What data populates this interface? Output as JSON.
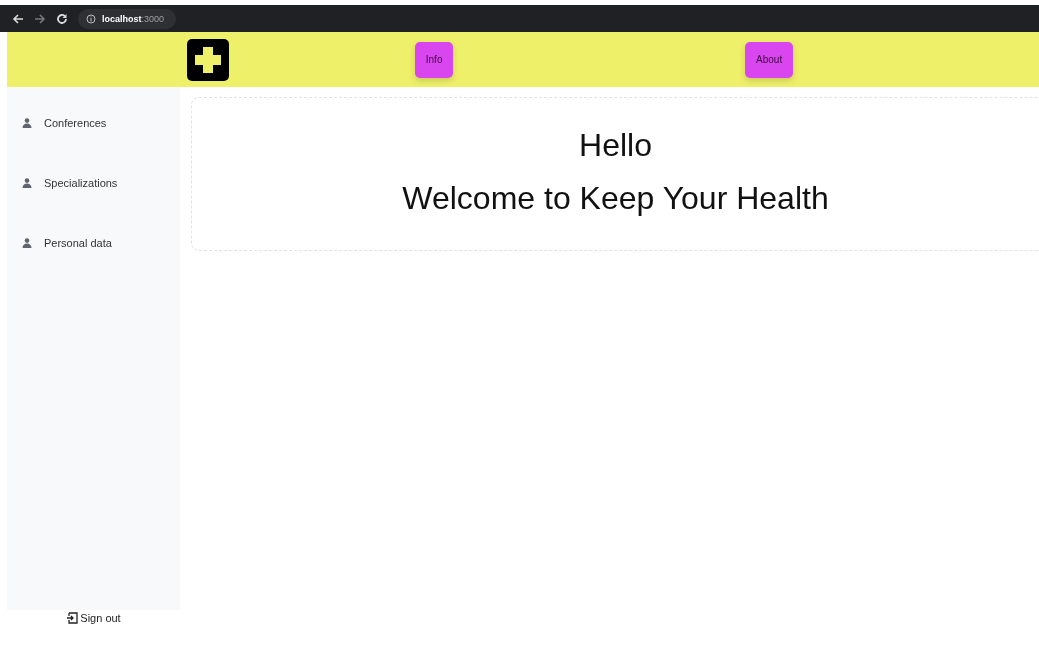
{
  "browser": {
    "address": "**localhost**:3000"
  },
  "header": {
    "nav": [
      {
        "label": "Info"
      },
      {
        "label": "About"
      }
    ]
  },
  "sidebar": {
    "items": [
      {
        "label": "Conferences"
      },
      {
        "label": "Specializations"
      },
      {
        "label": "Personal data"
      }
    ],
    "sign_out": "Sign out"
  },
  "card": {
    "greeting": "Hello",
    "welcome": "Welcome to Keep Your Health"
  }
}
